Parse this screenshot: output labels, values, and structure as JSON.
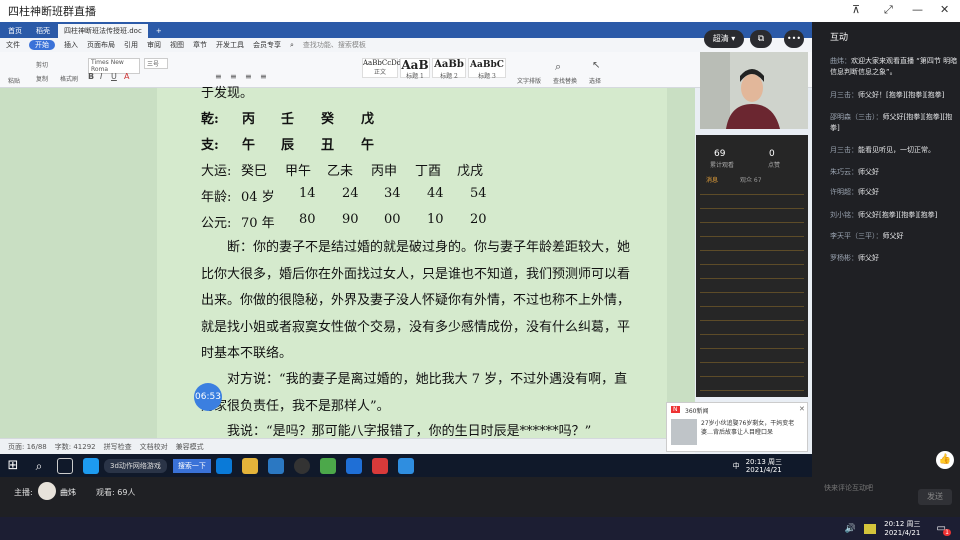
{
  "window": {
    "title": "四柱神断班群直播"
  },
  "wps": {
    "tabs": [
      {
        "label": "首页"
      },
      {
        "label": "稻壳"
      },
      {
        "label": "四柱神断班法传授班.doc"
      }
    ],
    "menu": [
      "文件",
      "开始",
      "插入",
      "页面布局",
      "引用",
      "审阅",
      "视图",
      "章节",
      "开发工具",
      "会员专享"
    ],
    "search_placeholder": "查找功能、搜索模板",
    "font_name": "Times New Roma",
    "font_size": "三号",
    "paste_label": "粘贴",
    "cut_label": "剪切",
    "copy_label": "复制",
    "format_painter_label": "格式刷",
    "styles": [
      {
        "preview": "AaBbCcDd",
        "label": "正文"
      },
      {
        "preview": "AaB",
        "label": "标题 1"
      },
      {
        "preview": "AaBb",
        "label": "标题 2"
      },
      {
        "preview": "AaBbC",
        "label": "标题 3"
      }
    ],
    "text_layout": "文字排版",
    "find_replace": "查找替换",
    "select": "选择"
  },
  "document": {
    "top_line": "于发现。",
    "qian_label": "乾:",
    "qian": [
      "丙",
      "壬",
      "癸",
      "戊"
    ],
    "zhi_label": "支:",
    "zhi": [
      "午",
      "辰",
      "丑",
      "午"
    ],
    "dayun_label": "大运:",
    "dayun": [
      "癸巳",
      "甲午",
      "乙未",
      "丙申",
      "丁酉",
      "戊戌"
    ],
    "age_label": "年龄:",
    "ages": [
      "04 岁",
      "14",
      "24",
      "34",
      "44",
      "54"
    ],
    "year_label": "公元:",
    "years": [
      "70 年",
      "80",
      "90",
      "00",
      "10",
      "20"
    ],
    "para1": "断：你的妻子不是结过婚的就是破过身的。你与妻子年龄差距较大，她比你大很多，婚后你在外面找过女人，只是谁也不知道，我们预测师可以看出来。你做的很隐秘，外界及妻子没人怀疑你有外情，不过也称不上外情，就是找小姐或者寂寞女性做个交易，没有多少感情成份，没有什么纠葛，平时基本不联络。",
    "para2": "对方说：“我的妻子是离过婚的，她比我大 7 岁，不过外遇没有啊，直对家很负责任，我不是那样人”。",
    "para3": "我说：“是吗？那可能八字报错了，你的生日时辰是******吗？”"
  },
  "timer": "06:53",
  "statusbar": {
    "page": "页面: 16/88",
    "words": "字数: 41292",
    "spell": "拼写检查",
    "doc_check": "文档校对",
    "compat": "兼容模式"
  },
  "inner_taskbar": {
    "time": "20:13 周三",
    "date": "2021/4/21",
    "search": "搜索一下",
    "app": "3d动作网络游戏",
    "lang": "中"
  },
  "live_controls": {
    "button": "超清",
    "more": "•••"
  },
  "stats": {
    "views": "69",
    "views_label": "累计观看",
    "likes": "0",
    "likes_label": "点赞",
    "tab_msg": "消息",
    "tab_viewers": "观众 67"
  },
  "notif": {
    "brand": "360新闻",
    "text": "27岁小伙追娶76岁剩女，干妈变老婆…背后故事让人目瞪口呆"
  },
  "chat": {
    "title": "互动",
    "messages": [
      {
        "user": "曲炜：",
        "text": "欢迎大家来观看直播 “第四节 明暗信息判断信息之象”。"
      },
      {
        "user": "月三击：",
        "text": "师父好！[抱拳][抱拳][抱拳]"
      },
      {
        "user": "邵明森（三击）：",
        "text": "师父好[抱拳][抱拳][抱拳]"
      },
      {
        "user": "月三击：",
        "text": "能看见听见，一切正常。"
      },
      {
        "user": "朱巧云：",
        "text": "师父好"
      },
      {
        "user": "许明超：",
        "text": "师父好"
      },
      {
        "user": "刘小铭：",
        "text": "师父好[抱拳][抱拳][抱拳]"
      },
      {
        "user": "李天平（三平）：",
        "text": "师父好"
      },
      {
        "user": "罗杨彬：",
        "text": "师父好"
      }
    ],
    "input_placeholder": "快来评论互动吧",
    "send": "发送"
  },
  "host": {
    "label": "主播:",
    "name": "曲炜",
    "viewers": "观看: 69人"
  },
  "system_taskbar": {
    "time": "20:12 周三",
    "date": "2021/4/21",
    "badge": "1"
  },
  "colors": {
    "accent": "#3a72d8",
    "doc_bg": "#d5eacd",
    "chat_bg": "#1f2024"
  }
}
